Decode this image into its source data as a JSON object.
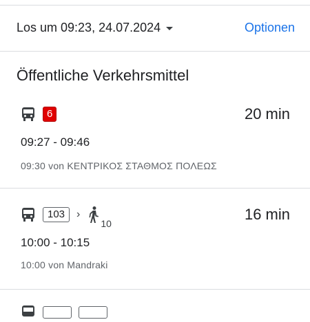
{
  "header": {
    "depart_label": "Los um 09:23, 24.07.2024",
    "options_label": "Optionen"
  },
  "section": {
    "title": "Öffentliche Verkehrsmittel"
  },
  "routes": [
    {
      "icon": "bus-icon",
      "line": "6",
      "line_color": "#e00000",
      "duration": "20 min",
      "times": "09:27 - 09:46",
      "from": "09:30 von ΚΕΝΤΡΙΚΟΣ ΣΤΑΘΜΟΣ ΠΟΛΕΩΣ"
    },
    {
      "icon": "bus-icon",
      "line": "103",
      "chevron": "›",
      "walk_icon": "walk-icon",
      "walk_minutes": "10",
      "duration": "16 min",
      "times": "10:00 - 10:15",
      "from": "10:00 von Mandraki"
    }
  ]
}
